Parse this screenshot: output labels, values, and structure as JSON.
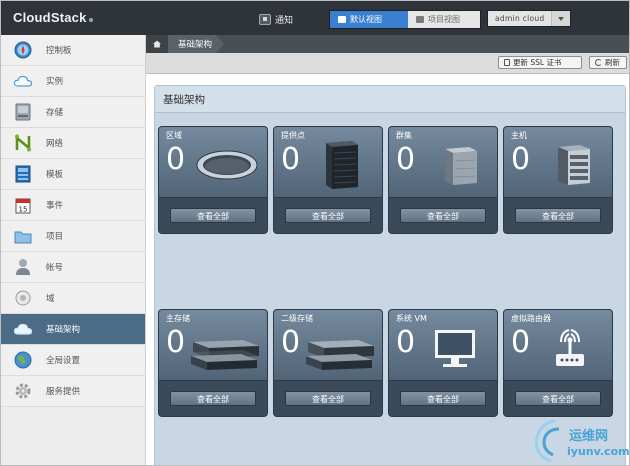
{
  "header": {
    "brand": "CloudStack",
    "notifications_label": "通知",
    "view_tabs": [
      {
        "label": "默认视图",
        "active": true
      },
      {
        "label": "项目视图",
        "active": false
      }
    ],
    "user_menu": "admin cloud"
  },
  "sidebar": {
    "items": [
      {
        "label": "控制板",
        "icon": "dashboard-compass-icon",
        "active": false
      },
      {
        "label": "实例",
        "icon": "cloud-icon",
        "active": false
      },
      {
        "label": "存储",
        "icon": "storage-disk-icon",
        "active": false
      },
      {
        "label": "网络",
        "icon": "network-icon",
        "active": false
      },
      {
        "label": "模板",
        "icon": "template-icon",
        "active": false
      },
      {
        "label": "事件",
        "icon": "calendar-icon",
        "active": false
      },
      {
        "label": "项目",
        "icon": "folder-icon",
        "active": false
      },
      {
        "label": "帐号",
        "icon": "user-icon",
        "active": false
      },
      {
        "label": "域",
        "icon": "domain-icon",
        "active": false
      },
      {
        "label": "基础架构",
        "icon": "infrastructure-cloud-icon",
        "active": true
      },
      {
        "label": "全局设置",
        "icon": "globe-settings-icon",
        "active": false
      },
      {
        "label": "服务提供",
        "icon": "gear-icon",
        "active": false
      }
    ]
  },
  "breadcrumb": {
    "home_icon": "home-icon",
    "current": "基础架构"
  },
  "toolbar": {
    "ssl_button": "更新 SSL 证书",
    "refresh_button": "刷新"
  },
  "panel": {
    "title": "基础架构",
    "tiles": [
      {
        "label": "区域",
        "count": "0",
        "button": "查看全部",
        "icon": "zone-ring-icon"
      },
      {
        "label": "提供点",
        "count": "0",
        "button": "查看全部",
        "icon": "pod-rack-icon"
      },
      {
        "label": "群集",
        "count": "0",
        "button": "查看全部",
        "icon": "cluster-box-icon"
      },
      {
        "label": "主机",
        "count": "0",
        "button": "查看全部",
        "icon": "host-server-icon"
      },
      {
        "label": "主存储",
        "count": "0",
        "button": "查看全部",
        "icon": "primary-storage-icon"
      },
      {
        "label": "二级存储",
        "count": "0",
        "button": "查看全部",
        "icon": "secondary-storage-icon"
      },
      {
        "label": "系统 VM",
        "count": "0",
        "button": "查看全部",
        "icon": "monitor-icon"
      },
      {
        "label": "虚拟路由器",
        "count": "0",
        "button": "查看全部",
        "icon": "router-icon"
      }
    ]
  },
  "watermark": {
    "line1": "运维网",
    "line2": "iyunv.com"
  }
}
